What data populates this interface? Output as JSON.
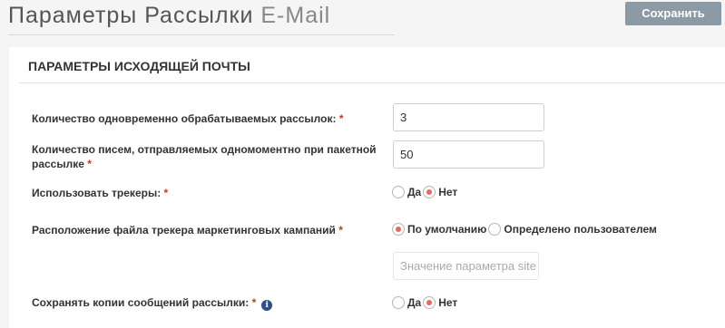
{
  "header": {
    "title": "Параметры Рассылки",
    "title_sub": "E-Mail",
    "save_label": "Сохранить"
  },
  "panel": {
    "title": "ПАРАМЕТРЫ ИСХОДЯЩЕЙ ПОЧТЫ"
  },
  "fields": {
    "concurrent_label": "Количество одновременно обрабатываемых рассылок:",
    "concurrent_value": "3",
    "batch_label": "Количество писем, отправляемых одномоментно при пакетной рассылке",
    "batch_value": "50",
    "trackers_label": "Использовать трекеры:",
    "trackers_options": {
      "yes": "Да",
      "no": "Нет",
      "selected": "Нет"
    },
    "tracker_location_label": "Расположение файла трекера маркетинговых кампаний",
    "tracker_location_options": {
      "default": "По умолчанию",
      "user": "Определено пользователем",
      "selected": "По умолчанию"
    },
    "tracker_url_placeholder": "Значение параметра site",
    "save_copies_label": "Сохранять копии сообщений рассылки:",
    "save_copies_options": {
      "yes": "Да",
      "no": "Нет",
      "selected": "Нет"
    },
    "required_mark": "*",
    "info_icon_glyph": "i"
  },
  "colors": {
    "save_button": "#8c9aa5",
    "required": "#d0312d",
    "radio_selected": "#e8685e",
    "info_icon": "#2e4e8f"
  }
}
